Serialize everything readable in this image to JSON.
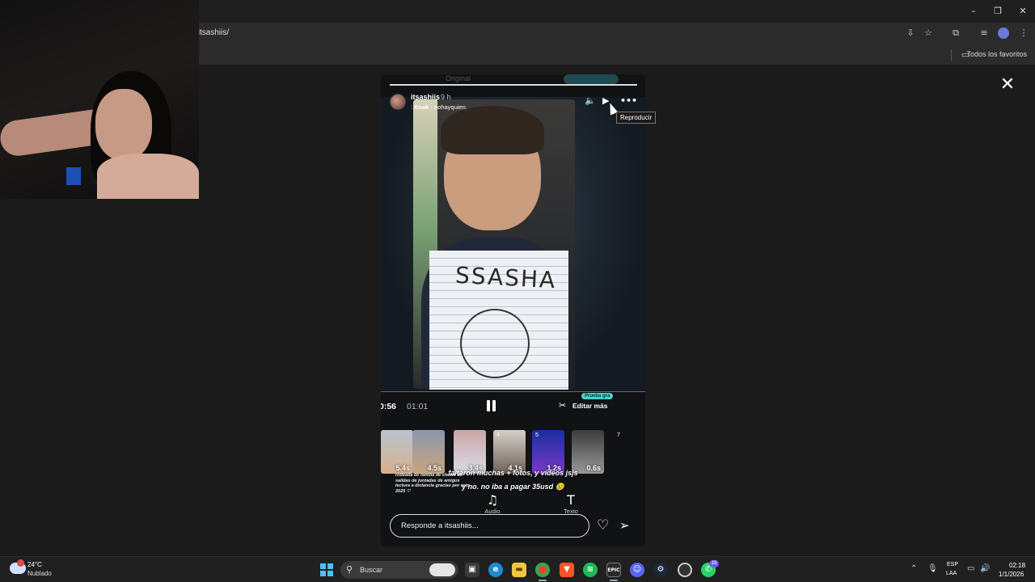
{
  "browser": {
    "url": "/itsashiis/",
    "bookmarks_label": "Todos los favoritos",
    "window_controls": [
      "minimize-icon",
      "restore-icon",
      "close-icon"
    ]
  },
  "story": {
    "ghost_tab": "Original",
    "username": "itsashiis",
    "time": "9 h",
    "song": "Knak · nohayquien.",
    "song_artist": "Knak",
    "song_title": "nohayquien.",
    "tooltip": "Reproducir",
    "overlay_text": "SSASHA",
    "current_time": "0:56",
    "duration": "01:01",
    "edit_more_label": "Editar más",
    "trial_badge": "Prueba gra",
    "thumbnails": [
      "5.4s",
      "4.5s",
      "3.4s",
      "4.1s",
      "1.2s",
      "0.6s"
    ],
    "thumbnail_index_7": "7",
    "thumbnail_index_4": "4",
    "thumbnail_index_5": "5",
    "caption_line1": "faltaron muchas + fotos, y videos jsjs",
    "caption_line2": "y no. no iba a pagar 35usd 😢",
    "side_note": "rodeada de familia de shows de salidas de juntadas de amigos lectura a distancia gracias por esto 2025 ♡",
    "audio_label": "Audio",
    "text_label": "Texto",
    "reply_placeholder": "Responde a itsashiis..."
  },
  "taskbar": {
    "temperature": "24°C",
    "condition": "Nublado",
    "search_label": "Buscar",
    "lang_line1": "ESP",
    "lang_line2": "LAA",
    "time": "02:18",
    "date": "1/1/2026",
    "notification_count": "18",
    "apps": [
      "file-explorer",
      "edge",
      "folder",
      "chrome",
      "brave",
      "spotify",
      "epic-games",
      "discord",
      "steam",
      "app-circle",
      "whatsapp"
    ],
    "epic_label": "EPIC"
  },
  "colors": {
    "accent": "#4bd2c8",
    "windows_blue": "#4cc2ff",
    "spotify": "#1db954",
    "brave": "#fb542b",
    "discord": "#5865f2",
    "whatsapp": "#25d366"
  }
}
